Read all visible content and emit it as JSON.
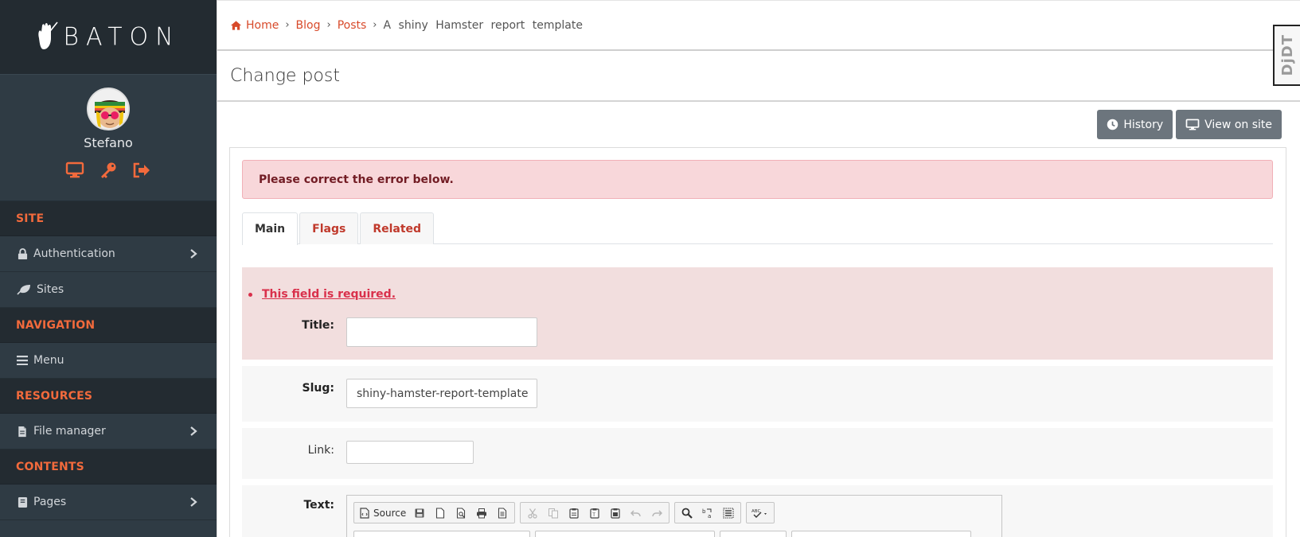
{
  "brand": {
    "logo_text": "BATON"
  },
  "user": {
    "name": "Stefano",
    "actions": [
      "desktop-icon",
      "key-icon",
      "sign-out-icon"
    ]
  },
  "sidebar": {
    "sections": [
      {
        "title": "SITE",
        "items": [
          {
            "label": "Authentication",
            "icon": "lock-icon",
            "has_children": true
          },
          {
            "label": "Sites",
            "icon": "leaf-icon",
            "has_children": false
          }
        ]
      },
      {
        "title": "NAVIGATION",
        "items": [
          {
            "label": "Menu",
            "icon": "bars-icon",
            "has_children": false
          }
        ]
      },
      {
        "title": "RESOURCES",
        "items": [
          {
            "label": "File manager",
            "icon": "file-icon",
            "has_children": true
          }
        ]
      },
      {
        "title": "CONTENTS",
        "items": [
          {
            "label": "Pages",
            "icon": "book-icon",
            "has_children": true
          }
        ]
      }
    ]
  },
  "breadcrumb": {
    "home": "Home",
    "blog": "Blog",
    "posts": "Posts",
    "current": "A shiny Hamster report template",
    "separator": "›"
  },
  "header": {
    "title": "Change post"
  },
  "debug_toolbar": {
    "label": "DjDT"
  },
  "object_tools": {
    "history": "History",
    "view_on_site": "View on site"
  },
  "errornote": "Please correct the error below.",
  "tabs": [
    {
      "label": "Main",
      "active": true
    },
    {
      "label": "Flags",
      "active": false
    },
    {
      "label": "Related",
      "active": false
    }
  ],
  "form": {
    "title": {
      "label": "Title:",
      "value": "",
      "error": "This field is required."
    },
    "slug": {
      "label": "Slug:",
      "value": "shiny-hamster-report-template"
    },
    "link": {
      "label": "Link:",
      "value": ""
    },
    "text": {
      "label": "Text:"
    }
  },
  "editor_toolbar": {
    "source_label": "Source",
    "groups": [
      [
        "source-icon",
        "save-icon",
        "new-page-icon",
        "preview-icon",
        "print-icon",
        "templates-icon"
      ],
      [
        "cut-icon",
        "copy-icon",
        "paste-icon",
        "paste-text-icon",
        "paste-word-icon",
        "undo-icon",
        "redo-icon"
      ],
      [
        "find-icon",
        "replace-icon",
        "select-all-icon"
      ],
      [
        "spellcheck-icon"
      ]
    ]
  },
  "colors": {
    "sidebar_bg": "#2f3b44",
    "sidebar_dark": "#232b31",
    "accent": "#f26a3c",
    "link": "#d84a2a",
    "error_bg": "#f8d7da",
    "button": "#6c757d"
  }
}
